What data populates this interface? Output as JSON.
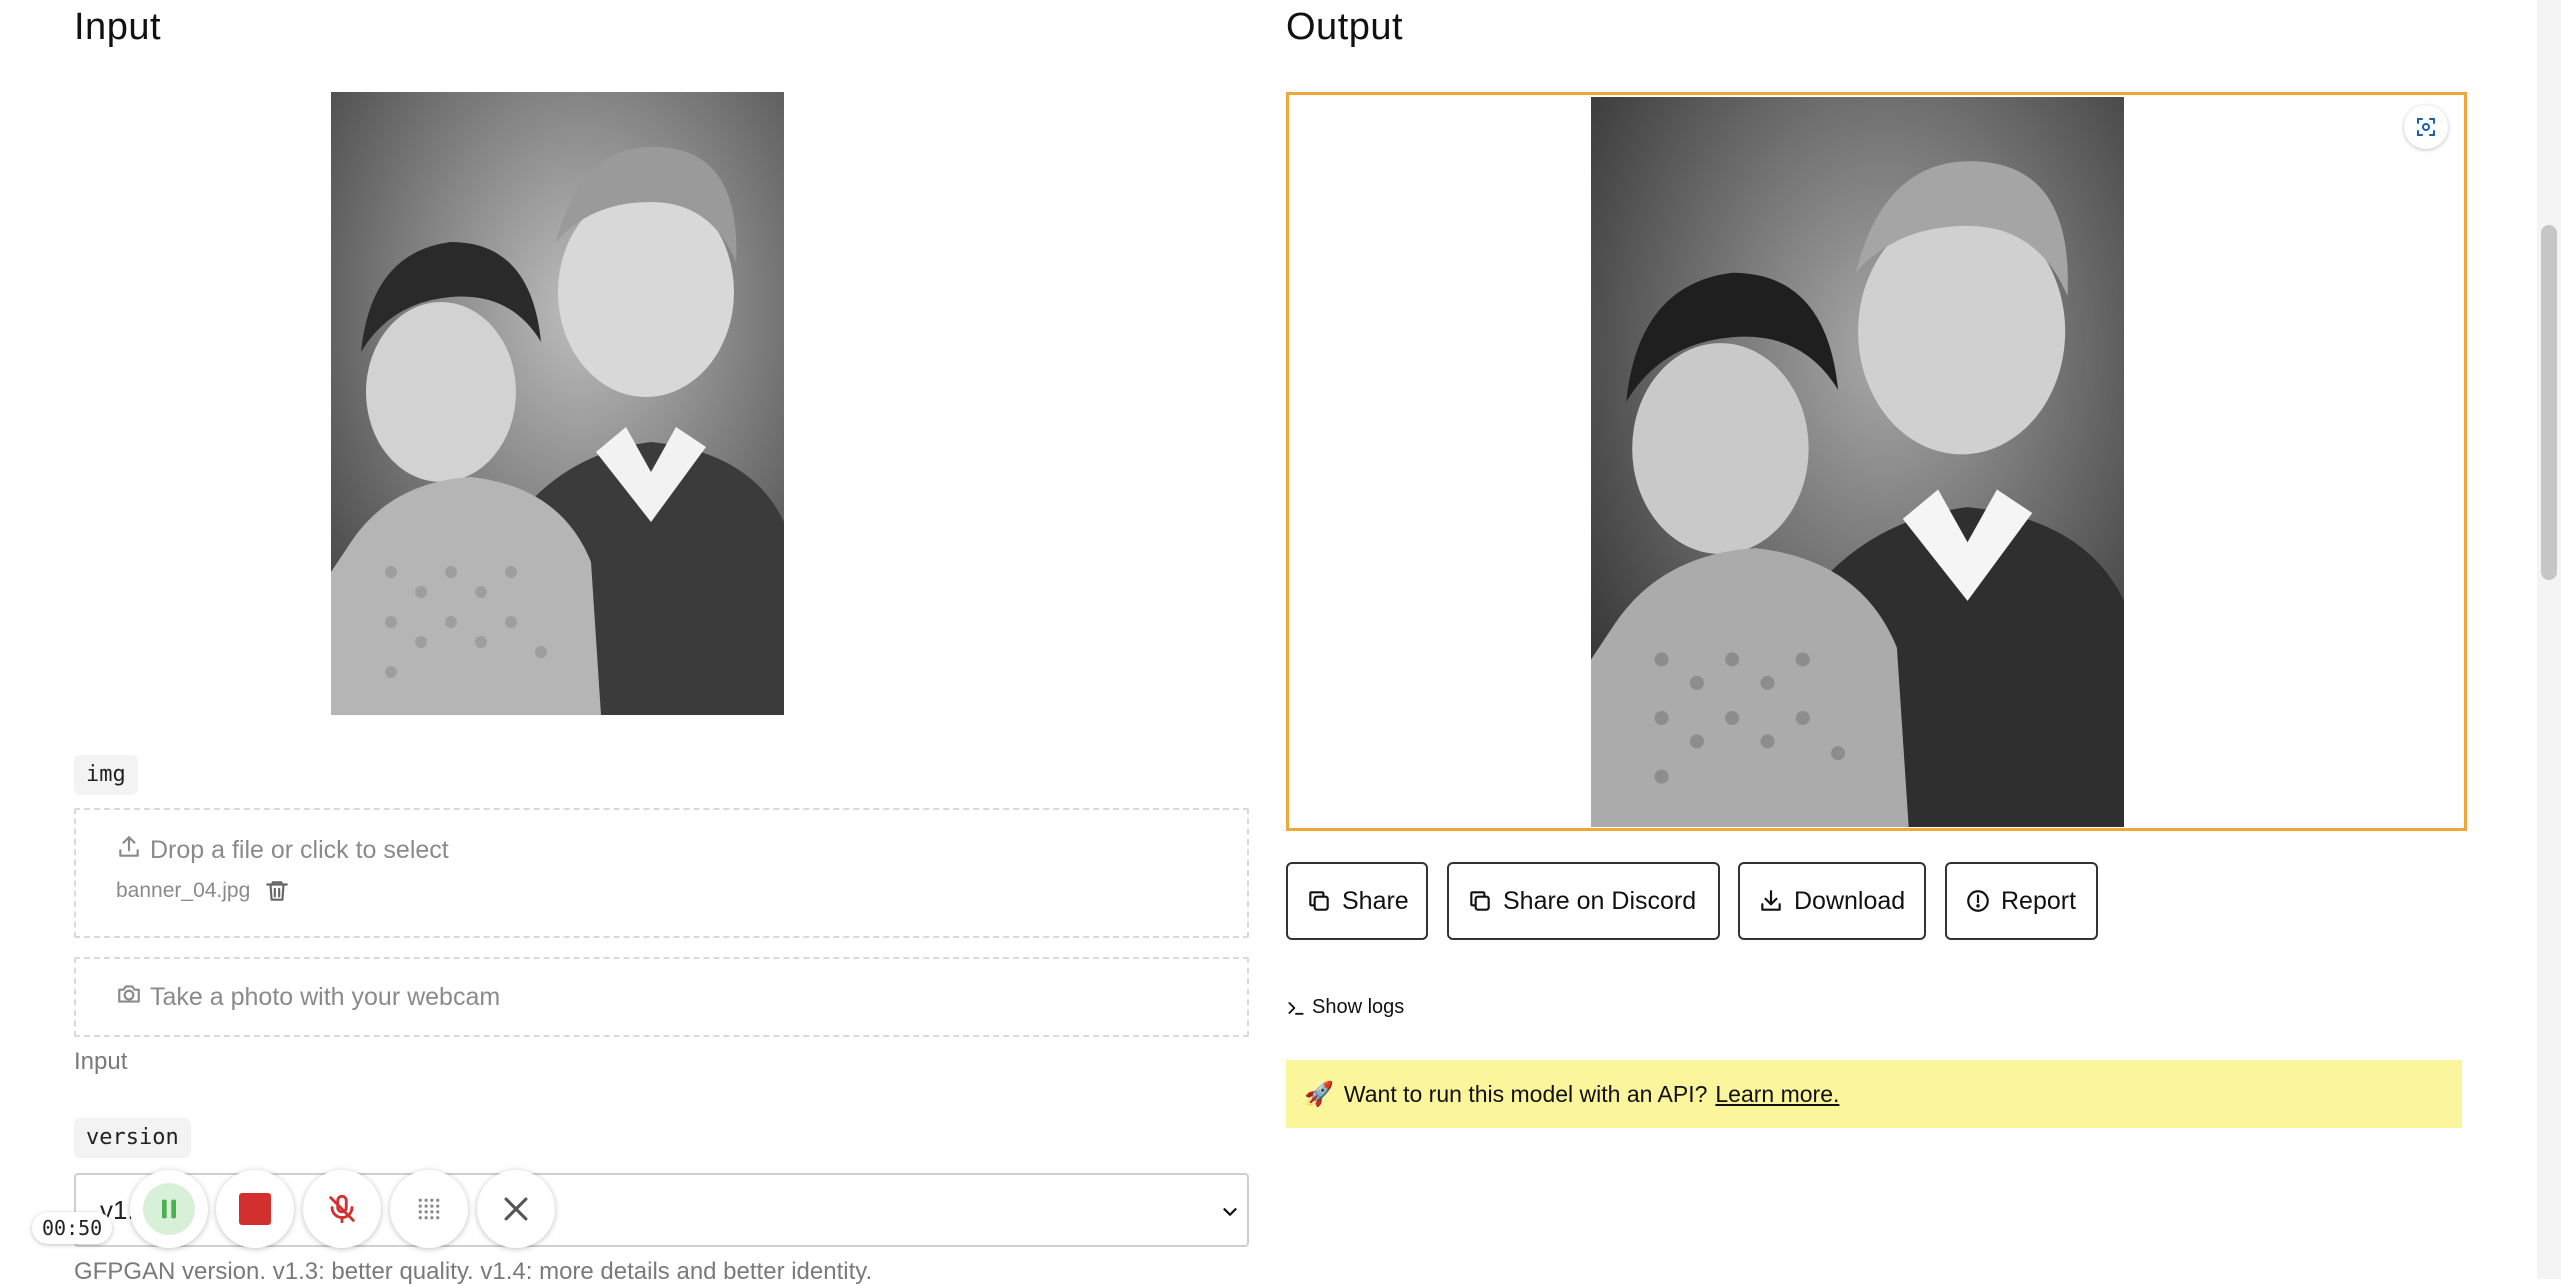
{
  "input": {
    "heading": "Input",
    "img_tag": "img",
    "dropzone_label": "Drop a file or click to select",
    "file_name": "banner_04.jpg",
    "webcam_label": "Take a photo with your webcam",
    "field_caption": "Input",
    "version_tag": "version",
    "version_value": "v1.",
    "version_help": "GFPGAN version. v1.3: better quality. v1.4: more details and better identity."
  },
  "output": {
    "heading": "Output",
    "buttons": {
      "share": "Share",
      "discord": "Share on Discord",
      "download": "Download",
      "report": "Report"
    },
    "show_logs": "Show logs",
    "api_banner": {
      "emoji": "🚀",
      "text": "Want to run this model with an API?",
      "link": "Learn more."
    }
  },
  "recorder": {
    "timer": "00:50"
  },
  "colors": {
    "output_border": "#f0a63b",
    "banner_bg": "#fbf59c",
    "pause_green": "#4caf50",
    "stop_red": "#d32f2f",
    "mic_red": "#d32f2f"
  },
  "icons": [
    "upload-icon",
    "trash-icon",
    "camera-icon",
    "chevron-down-icon",
    "zoom-screenshot-icon",
    "copy-icon",
    "download-icon",
    "alert-circle-icon",
    "terminal-icon",
    "rocket-icon",
    "pause-icon",
    "stop-icon",
    "mic-off-icon",
    "grid-icon",
    "close-icon"
  ]
}
